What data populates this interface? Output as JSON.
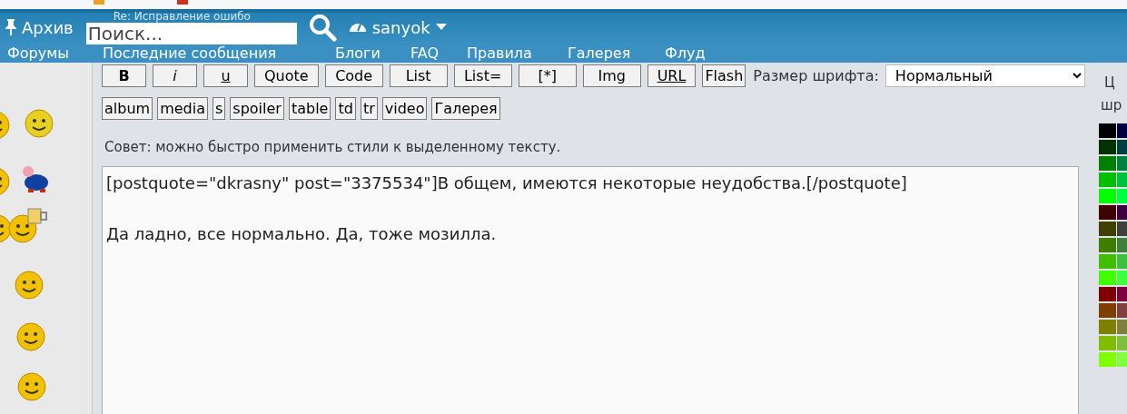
{
  "header": {
    "archive": "Архив",
    "page_title": "Re: Исправление ошибо",
    "search": {
      "placeholder": "Поиск..."
    },
    "user": "sanyok"
  },
  "nav": [
    "Форумы",
    "Последние сообщения",
    "Блоги",
    "FAQ",
    "Правила",
    "Галерея",
    "Флуд"
  ],
  "toolbar_row_1": [
    {
      "label": "B",
      "kind": "bold"
    },
    {
      "label": "i",
      "kind": "italic"
    },
    {
      "label": "u",
      "kind": "underline"
    },
    {
      "label": "Quote",
      "kind": "plain"
    },
    {
      "label": "Code",
      "kind": "plain"
    },
    {
      "label": "List",
      "kind": "plain"
    },
    {
      "label": "List=",
      "kind": "plain"
    },
    {
      "label": "[*]",
      "kind": "plain"
    },
    {
      "label": "Img",
      "kind": "plain"
    },
    {
      "label": "URL",
      "kind": "underline"
    },
    {
      "label": "Flash",
      "kind": "compact"
    }
  ],
  "font_size": {
    "label": "Размер шрифта:",
    "value": "Нормальный"
  },
  "toolbar_row_2": [
    "album",
    "media",
    "s",
    "spoiler",
    "table",
    "td",
    "tr",
    "video",
    "Галерея"
  ],
  "hint": "Совет: можно быстро применить стили к выделенному тексту.",
  "message": "[postquote=\"dkrasny\" post=\"3375534\"]В общем, имеются некоторые неудобства.[/postquote]\n\nДа ладно, все нормально. Да, тоже мозилла.",
  "palette": {
    "heading": [
      "Ц",
      "шр"
    ],
    "swatches": [
      {
        "color": "#000000"
      },
      {
        "color": "#00003f"
      },
      {
        "color": "#003300"
      },
      {
        "color": "#003f3f"
      },
      {
        "color": "#007f00"
      },
      {
        "color": "#007f3f"
      },
      {
        "color": "#00bf00"
      },
      {
        "color": "#00bf3f"
      },
      {
        "color": "#00ff00"
      },
      {
        "color": "#00ff3f"
      },
      {
        "color": "#3f0000"
      },
      {
        "color": "#3f003f"
      },
      {
        "color": "#3f3f00"
      },
      {
        "color": "#3f3f3f"
      },
      {
        "color": "#3f7f00"
      },
      {
        "color": "#3f7f3f"
      },
      {
        "color": "#3fbf00"
      },
      {
        "color": "#3fbf3f"
      },
      {
        "color": "#3fff00"
      },
      {
        "color": "#3fff3f"
      },
      {
        "color": "#7f0000"
      },
      {
        "color": "#7f003f"
      },
      {
        "color": "#7f3f00"
      },
      {
        "color": "#7f3f3f"
      },
      {
        "color": "#7f7f00"
      },
      {
        "color": "#7f7f3f"
      },
      {
        "color": "#7fbf00"
      },
      {
        "color": "#7fbf3f"
      },
      {
        "color": "#7fff00"
      },
      {
        "color": "#7fff3f"
      }
    ]
  }
}
